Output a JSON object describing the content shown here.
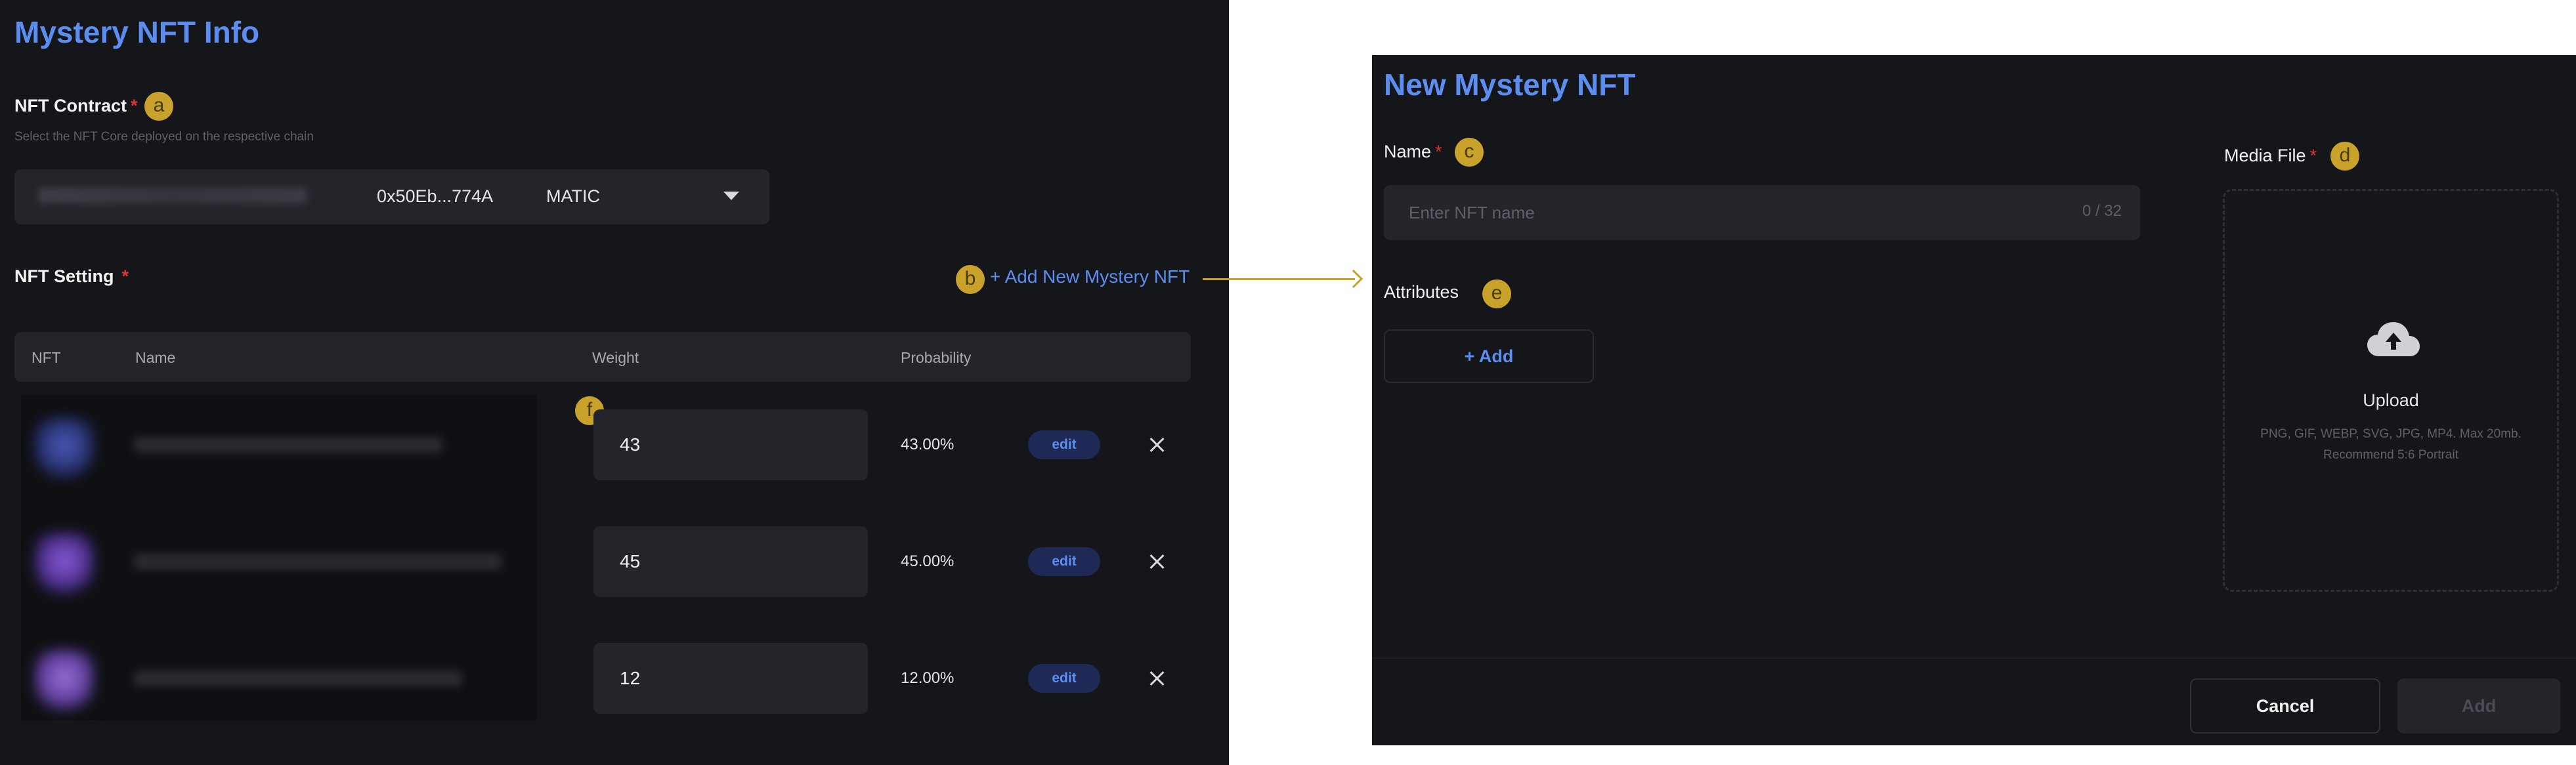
{
  "left_panel": {
    "title": "Mystery NFT Info",
    "contract": {
      "label": "NFT Contract",
      "required_mark": "*",
      "hint": "Select the NFT Core deployed on the respective chain",
      "address": "0x50Eb...774A",
      "chain": "MATIC",
      "badge": "a"
    },
    "setting": {
      "label": "NFT Setting",
      "required_mark": "*",
      "add_link": "+ Add New Mystery NFT",
      "add_badge": "b",
      "weight_badge": "f"
    },
    "table": {
      "headers": [
        "NFT",
        "Name",
        "Weight",
        "Probability"
      ],
      "rows": [
        {
          "weight": "43",
          "probability": "43.00%",
          "edit_label": "edit"
        },
        {
          "weight": "45",
          "probability": "45.00%",
          "edit_label": "edit"
        },
        {
          "weight": "12",
          "probability": "12.00%",
          "edit_label": "edit"
        }
      ]
    }
  },
  "right_panel": {
    "title": "New Mystery NFT",
    "name": {
      "label": "Name",
      "required_mark": "*",
      "badge": "c",
      "placeholder": "Enter NFT name",
      "counter": "0 / 32"
    },
    "attributes": {
      "label": "Attributes",
      "badge": "e",
      "add_label": "+ Add"
    },
    "media": {
      "label": "Media File",
      "required_mark": "*",
      "badge": "d",
      "upload_label": "Upload",
      "hint_line1": "PNG, GIF, WEBP, SVG, JPG, MP4. Max 20mb.",
      "hint_line2": "Recommend 5:6 Portrait"
    },
    "footer": {
      "cancel_label": "Cancel",
      "add_label": "Add"
    }
  },
  "colors": {
    "accent": "#5b8ef0",
    "badge": "#c9a22c",
    "required": "#e0343b",
    "panel_bg": "#15161a",
    "input_bg": "#24252b"
  }
}
